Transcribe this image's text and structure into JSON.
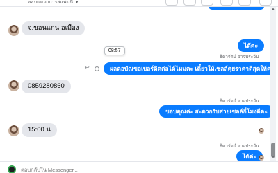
{
  "header": {
    "subtitle": "ลลบแมวกการสแพนนี ▼"
  },
  "tooltip": {
    "time": "08:57"
  },
  "messages": {
    "in_1": "จ.ขอนแก่น.อเมือง",
    "out_1": "ได้ค่ะ",
    "sender_1": "ธิดารัตน์ อาจประจัน",
    "out_2": "ผลตอบัณขอเบอร์ติดต่อได้ไหมคะ เดี๋ยวให้เซลล์คุยราคาดีสุดให้ค่ะ",
    "in_2": "0859280860",
    "sender_2": "ธิดารัตน์ อาจประจัน",
    "out_3": "ขอบคุณค่ะ สะดวกรับสายเซลล์กี่โมงดีคะ",
    "in_3": "15:00 น",
    "sender_3": "ธิดารัตน์ อาจประจัน",
    "out_4": "ได้ค่ะ"
  },
  "composer": {
    "placeholder": "ตอบกลับใน Messenger..."
  },
  "colors": {
    "accent": "#0a7cff",
    "incoming_bubble": "#e4e6eb",
    "meta_text": "#65676b"
  }
}
